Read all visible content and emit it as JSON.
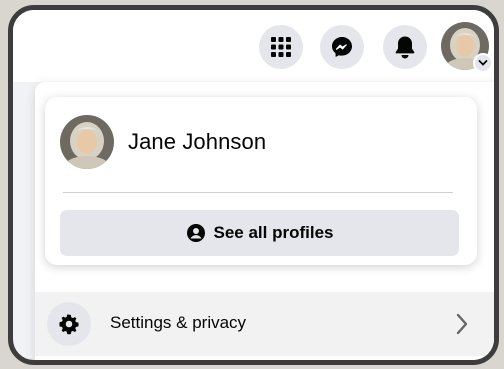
{
  "user": {
    "name": "Jane Johnson"
  },
  "topbar": {
    "icons": [
      "menu-grid-icon",
      "messenger-icon",
      "bell-icon",
      "avatar",
      "chevron-down-icon"
    ]
  },
  "profile_menu": {
    "see_all_label": "See all profiles",
    "settings_label": "Settings & privacy"
  },
  "colors": {
    "button_bg": "#e4e6eb",
    "text": "#050505",
    "divider": "#ced0d4"
  }
}
